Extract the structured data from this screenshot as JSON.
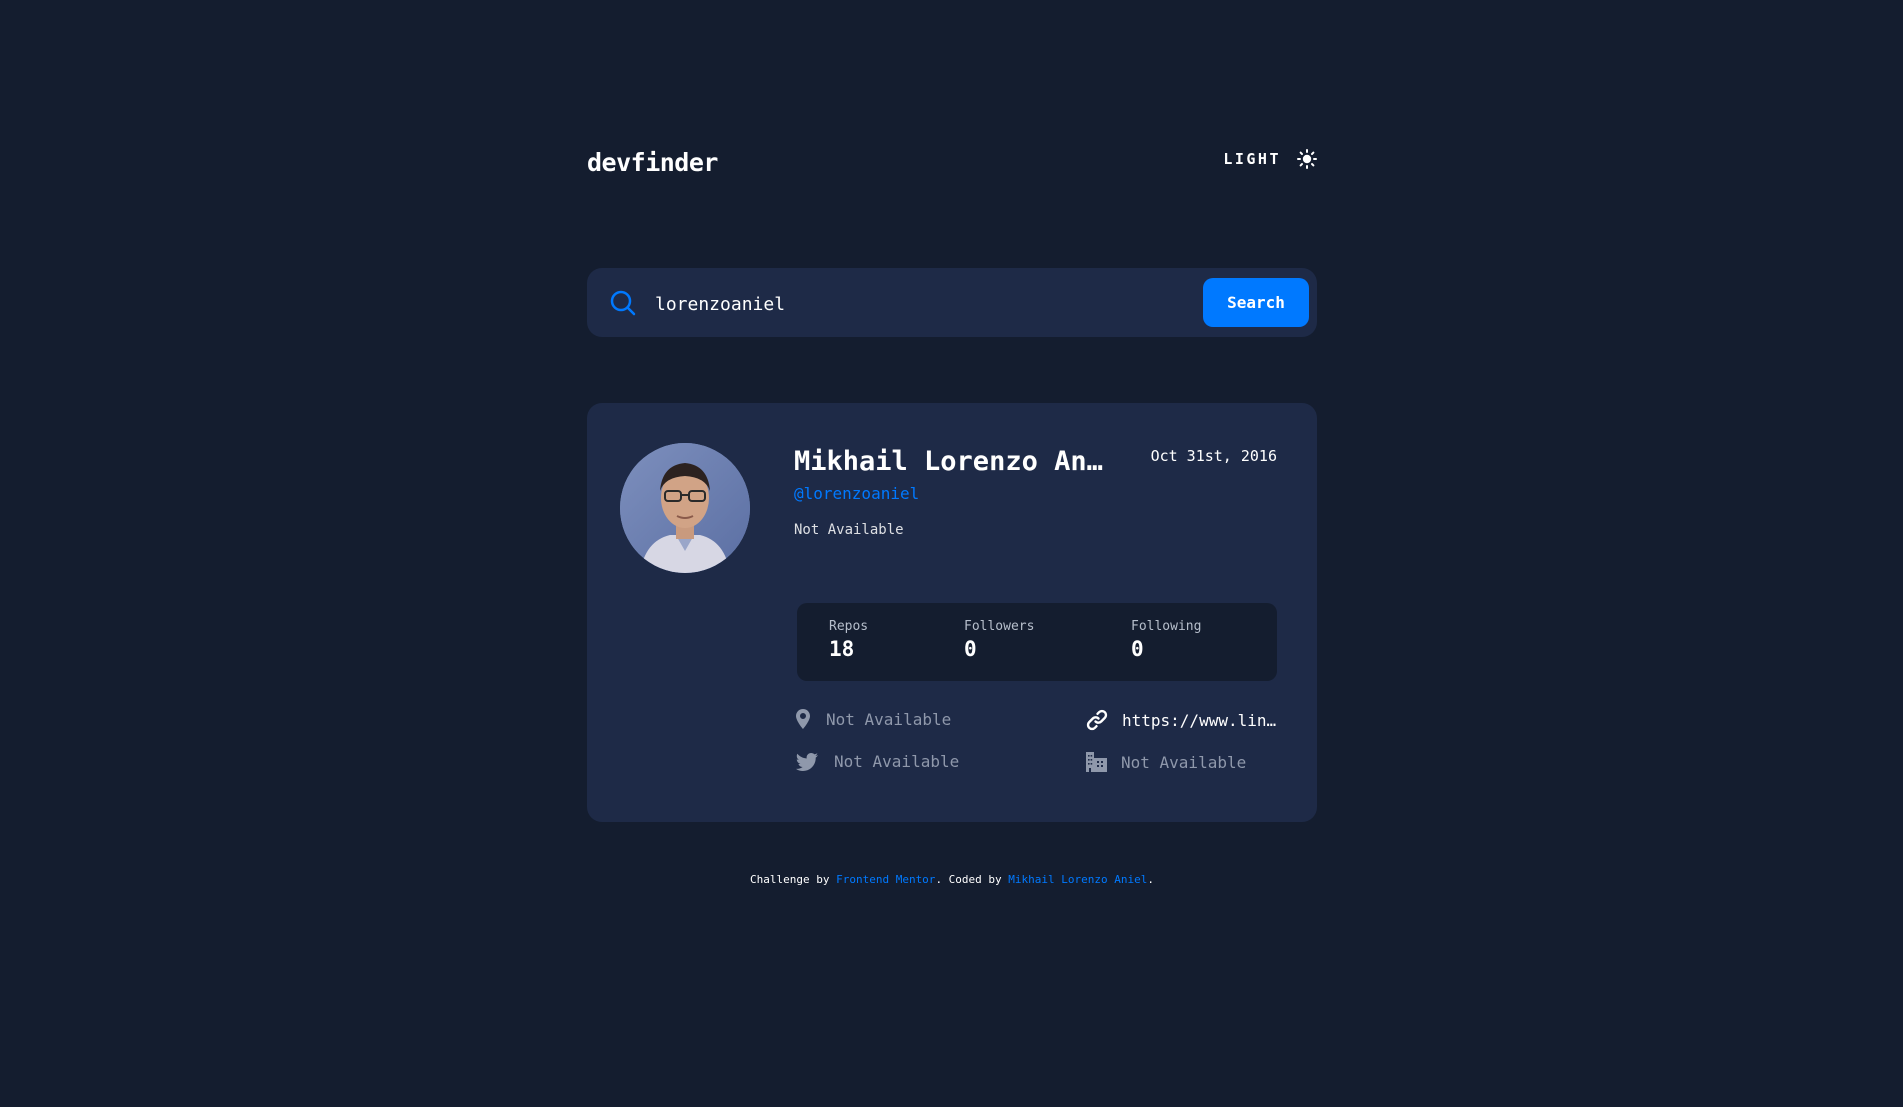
{
  "header": {
    "logo": "devfinder",
    "theme_label": "LIGHT",
    "theme_icon": "sun-icon"
  },
  "search": {
    "icon": "search-icon",
    "value": "lorenzoaniel",
    "button_label": "Search"
  },
  "profile": {
    "name": "Mikhail Lorenzo Ani…",
    "joined": "Oct 31st, 2016",
    "handle": "@lorenzoaniel",
    "bio": "Not Available",
    "stats": [
      {
        "label": "Repos",
        "value": "18"
      },
      {
        "label": "Followers",
        "value": "0"
      },
      {
        "label": "Following",
        "value": "0"
      }
    ],
    "links": {
      "location": {
        "icon": "location-pin-icon",
        "text": "Not Available"
      },
      "website": {
        "icon": "link-icon",
        "text": "https://www.lin…"
      },
      "twitter": {
        "icon": "twitter-icon",
        "text": "Not Available"
      },
      "company": {
        "icon": "building-icon",
        "text": "Not Available"
      }
    }
  },
  "footer": {
    "prefix": "Challenge by ",
    "link1": "Frontend Mentor",
    "middle": ". Coded by ",
    "link2": "Mikhail Lorenzo Aniel",
    "suffix": "."
  },
  "colors": {
    "background": "#141d2f",
    "card": "#1e2a47",
    "accent": "#0079ff",
    "muted_text": "#8f98ab"
  }
}
